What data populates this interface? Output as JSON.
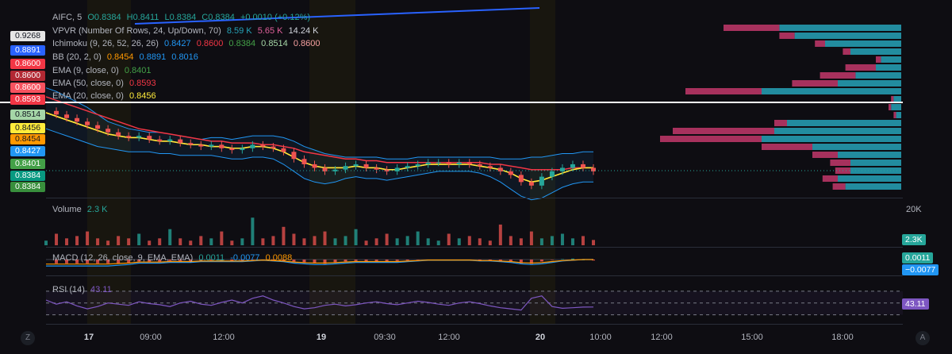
{
  "symbol_legend": {
    "name": "AIFC, 5",
    "o": "O0.8384",
    "h": "H0.8411",
    "l": "L0.8384",
    "c": "C0.8384",
    "chg": "+0.0010 (+0.12%)"
  },
  "vpvr_legend": {
    "name": "VPVR (Number Of Rows, 24, Up/Down, 70)",
    "up": "8.59 K",
    "down": "5.65 K",
    "total": "14.24 K"
  },
  "ichimoku_legend": {
    "name": "Ichimoku (9, 26, 52, 26, 26)",
    "v1": "0.8427",
    "v2": "0.8600",
    "v3": "0.8384",
    "v4": "0.8514",
    "v5": "0.8600"
  },
  "bb_legend": {
    "name": "BB (20, 2, 0)",
    "v1": "0.8454",
    "v2": "0.8891",
    "v3": "0.8016"
  },
  "ema9_legend": {
    "name": "EMA (9, close, 0)",
    "v": "0.8401"
  },
  "ema50_legend": {
    "name": "EMA (50, close, 0)",
    "v": "0.8593"
  },
  "ema20_legend": {
    "name": "EMA (20, close, 0)",
    "v": "0.8456"
  },
  "volume_legend": {
    "name": "Volume",
    "v": "2.3 K"
  },
  "macd_legend": {
    "name": "MACD (12, 26, close, 9, EMA, EMA)",
    "v1": "0.0011",
    "v2": "-0.0077",
    "v3": "0.0088"
  },
  "rsi_legend": {
    "name": "RSI (14)",
    "v": "43.11"
  },
  "left_price_tags": [
    {
      "label": "0.9268",
      "bg": "#e6e6e6",
      "fg": "#131722"
    },
    {
      "label": "0.8891",
      "bg": "#2962ff",
      "fg": "#ffffff"
    },
    {
      "label": "0.8600",
      "bg": "#f23645",
      "fg": "#ffffff"
    },
    {
      "label": "0.8600",
      "bg": "#b22833",
      "fg": "#ffffff"
    },
    {
      "label": "0.8600",
      "bg": "#f7525f",
      "fg": "#ffffff"
    },
    {
      "label": "0.8593",
      "bg": "#f23645",
      "fg": "#ffffff"
    },
    {
      "label": "0.8514",
      "bg": "#a5d6a7",
      "fg": "#131722"
    },
    {
      "label": "0.8456",
      "bg": "#ffeb3b",
      "fg": "#131722"
    },
    {
      "label": "0.8454",
      "bg": "#ff9800",
      "fg": "#131722"
    },
    {
      "label": "0.8427",
      "bg": "#2196f3",
      "fg": "#ffffff"
    },
    {
      "label": "0.8401",
      "bg": "#43a047",
      "fg": "#ffffff"
    },
    {
      "label": "0.8384",
      "bg": "#089981",
      "fg": "#ffffff"
    },
    {
      "label": "0.8384",
      "bg": "#388e3c",
      "fg": "#ffffff"
    }
  ],
  "right_axis": {
    "volume_max": "20K",
    "volume_tag": "2.3K",
    "macd_tag1": "0.0011",
    "macd_tag2": "−0.0077",
    "rsi_tag": "43.11"
  },
  "x_axis": [
    {
      "label": "17",
      "bold": true
    },
    {
      "label": "09:00",
      "bold": false
    },
    {
      "label": "12:00",
      "bold": false
    },
    {
      "label": "19",
      "bold": true
    },
    {
      "label": "09:30",
      "bold": false
    },
    {
      "label": "12:00",
      "bold": false
    },
    {
      "label": "20",
      "bold": true
    },
    {
      "label": "10:00",
      "bold": false
    },
    {
      "label": "12:00",
      "bold": false
    },
    {
      "label": "15:00",
      "bold": false
    },
    {
      "label": "18:00",
      "bold": false
    }
  ],
  "corner_buttons": {
    "left": "Z",
    "right": "A"
  },
  "colors": {
    "up": "#26a69a",
    "down": "#ef5350",
    "ema9": "#ffeb3b",
    "ema20": "#ff9800",
    "ema50": "#f23645",
    "bb": "#2196f3",
    "vpvr_up": "#26a3b8",
    "vpvr_down": "#c2386b",
    "rsi": "#7e57c2"
  },
  "chart_data": {
    "type": "candlestick",
    "symbol": "AIFC",
    "interval": "5",
    "sessions": [
      "17",
      "19",
      "20"
    ],
    "last_close": 0.8384,
    "price_range": [
      0.825,
      0.93
    ],
    "close_series": [
      0.872,
      0.87,
      0.868,
      0.866,
      0.864,
      0.862,
      0.86,
      0.858,
      0.857,
      0.858,
      0.856,
      0.855,
      0.856,
      0.854,
      0.853,
      0.852,
      0.853,
      0.851,
      0.85,
      0.851,
      0.853,
      0.852,
      0.851,
      0.849,
      0.845,
      0.842,
      0.84,
      0.838,
      0.839,
      0.841,
      0.842,
      0.84,
      0.839,
      0.838,
      0.84,
      0.841,
      0.842,
      0.843,
      0.843,
      0.842,
      0.843,
      0.842,
      0.841,
      0.84,
      0.838,
      0.836,
      0.832,
      0.83,
      0.835,
      0.838,
      0.84,
      0.842,
      0.84,
      0.838
    ],
    "ema9_series": [
      0.871,
      0.869,
      0.867,
      0.865,
      0.863,
      0.861,
      0.859,
      0.858,
      0.857,
      0.857,
      0.856,
      0.855,
      0.855,
      0.854,
      0.853,
      0.853,
      0.852,
      0.852,
      0.851,
      0.851,
      0.852,
      0.852,
      0.851,
      0.849,
      0.846,
      0.843,
      0.841,
      0.84,
      0.84,
      0.84,
      0.841,
      0.84,
      0.84,
      0.839,
      0.839,
      0.84,
      0.841,
      0.842,
      0.842,
      0.842,
      0.842,
      0.842,
      0.841,
      0.84,
      0.839,
      0.837,
      0.834,
      0.832,
      0.833,
      0.835,
      0.837,
      0.839,
      0.84,
      0.84
    ],
    "ema50_series": [
      0.88,
      0.878,
      0.876,
      0.874,
      0.872,
      0.87,
      0.868,
      0.866,
      0.864,
      0.862,
      0.861,
      0.86,
      0.859,
      0.858,
      0.857,
      0.856,
      0.855,
      0.855,
      0.854,
      0.854,
      0.854,
      0.853,
      0.853,
      0.852,
      0.851,
      0.849,
      0.848,
      0.847,
      0.846,
      0.845,
      0.845,
      0.844,
      0.844,
      0.843,
      0.843,
      0.843,
      0.843,
      0.843,
      0.843,
      0.843,
      0.843,
      0.843,
      0.843,
      0.842,
      0.842,
      0.841,
      0.84,
      0.839,
      0.839,
      0.839,
      0.839,
      0.84,
      0.84,
      0.84
    ],
    "bb_upper": [
      0.885,
      0.883,
      0.88,
      0.877,
      0.874,
      0.87,
      0.866,
      0.864,
      0.862,
      0.861,
      0.86,
      0.86,
      0.859,
      0.858,
      0.857,
      0.856,
      0.857,
      0.857,
      0.856,
      0.857,
      0.858,
      0.858,
      0.858,
      0.857,
      0.855,
      0.852,
      0.85,
      0.848,
      0.847,
      0.846,
      0.846,
      0.846,
      0.846,
      0.845,
      0.845,
      0.845,
      0.846,
      0.846,
      0.846,
      0.846,
      0.846,
      0.846,
      0.846,
      0.846,
      0.845,
      0.845,
      0.845,
      0.846,
      0.846,
      0.847,
      0.848,
      0.848,
      0.849,
      0.849
    ],
    "bb_lower": [
      0.862,
      0.86,
      0.858,
      0.856,
      0.854,
      0.852,
      0.851,
      0.85,
      0.849,
      0.849,
      0.849,
      0.848,
      0.848,
      0.847,
      0.847,
      0.847,
      0.847,
      0.846,
      0.845,
      0.845,
      0.846,
      0.846,
      0.845,
      0.842,
      0.838,
      0.834,
      0.832,
      0.831,
      0.832,
      0.834,
      0.835,
      0.834,
      0.834,
      0.833,
      0.834,
      0.835,
      0.836,
      0.837,
      0.838,
      0.838,
      0.838,
      0.838,
      0.837,
      0.835,
      0.832,
      0.828,
      0.824,
      0.822,
      0.823,
      0.826,
      0.829,
      0.831,
      0.832,
      0.832
    ],
    "volume_series": [
      2,
      5,
      3,
      4,
      6,
      3,
      2,
      4,
      3,
      5,
      2,
      3,
      7,
      3,
      2,
      4,
      3,
      6,
      2,
      3,
      12,
      3,
      4,
      8,
      5,
      3,
      4,
      6,
      3,
      4,
      7,
      2,
      3,
      5,
      3,
      4,
      6,
      3,
      2,
      5,
      3,
      4,
      3,
      2,
      9,
      4,
      3,
      6,
      3,
      4,
      5,
      3,
      4,
      2.3
    ],
    "volume_max": 20,
    "macd": 0.0011,
    "macd_signal": -0.0077,
    "macd_hist": 0.0088,
    "rsi_series": [
      55,
      48,
      52,
      45,
      40,
      44,
      50,
      48,
      46,
      52,
      49,
      47,
      44,
      50,
      53,
      48,
      46,
      51,
      55,
      50,
      58,
      62,
      55,
      50,
      44,
      40,
      42,
      46,
      48,
      45,
      47,
      50,
      52,
      49,
      47,
      50,
      53,
      51,
      48,
      46,
      50,
      52,
      49,
      45,
      42,
      40,
      38,
      58,
      62,
      44,
      41,
      42,
      43,
      43.11
    ],
    "rsi_last": 43.11,
    "vpvr_rows": [
      {
        "up": 0.48,
        "down": 0.22
      },
      {
        "up": 0.42,
        "down": 0.06
      },
      {
        "up": 0.3,
        "down": 0.04
      },
      {
        "up": 0.2,
        "down": 0.03
      },
      {
        "up": 0.08,
        "down": 0.02
      },
      {
        "up": 0.1,
        "down": 0.12
      },
      {
        "up": 0.18,
        "down": 0.14
      },
      {
        "up": 0.25,
        "down": 0.18
      },
      {
        "up": 0.55,
        "down": 0.3
      },
      {
        "up": 0.03,
        "down": 0.01
      },
      {
        "up": 0.04,
        "down": 0.01
      },
      {
        "up": 0.02,
        "down": 0.01
      },
      {
        "up": 0.45,
        "down": 0.05
      },
      {
        "up": 0.5,
        "down": 0.4
      },
      {
        "up": 0.55,
        "down": 0.4
      },
      {
        "up": 0.35,
        "down": 0.2
      },
      {
        "up": 0.25,
        "down": 0.1
      },
      {
        "up": 0.2,
        "down": 0.08
      },
      {
        "up": 0.2,
        "down": 0.06
      },
      {
        "up": 0.25,
        "down": 0.06
      },
      {
        "up": 0.22,
        "down": 0.05
      }
    ]
  }
}
